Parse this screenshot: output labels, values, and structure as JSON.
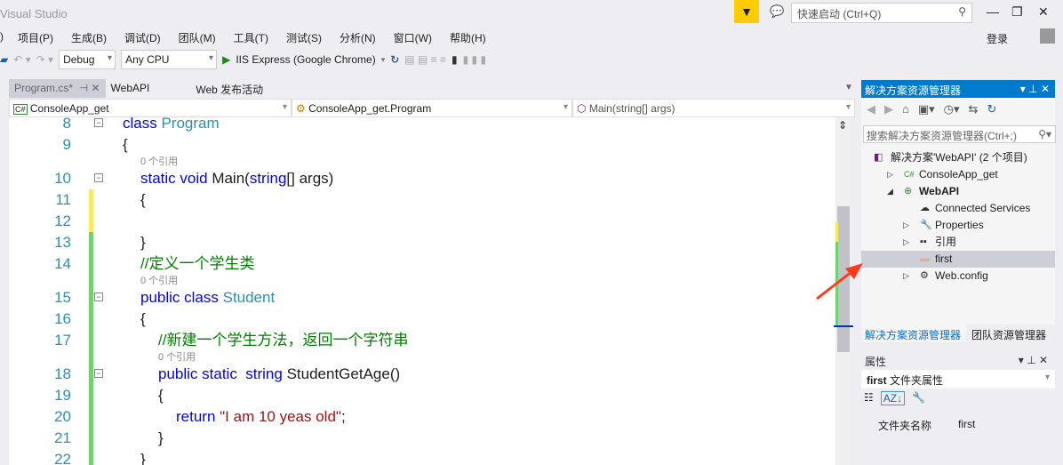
{
  "window": {
    "title": "Visual Studio",
    "quick_launch_placeholder": "快速启动 (Ctrl+Q)",
    "login": "登录"
  },
  "menu": [
    "项目(P)",
    "生成(B)",
    "调试(D)",
    "团队(M)",
    "工具(T)",
    "测试(S)",
    "分析(N)",
    "窗口(W)",
    "帮助(H)"
  ],
  "toolbar": {
    "config": "Debug",
    "platform": "Any CPU",
    "run": "IIS Express (Google Chrome)"
  },
  "tabs": [
    {
      "label": "Program.cs*",
      "active": true
    },
    {
      "label": "WebAPI"
    },
    {
      "label": "Web 发布活动"
    }
  ],
  "nav": {
    "project": "ConsoleApp_get",
    "type": "ConsoleApp_get.Program",
    "member": "Main(string[] args)"
  },
  "code": [
    {
      "type": "line",
      "n": "8",
      "indent": 0,
      "fold": true,
      "tokens": [
        [
          "kw",
          "class "
        ],
        [
          "ty",
          "Program"
        ]
      ]
    },
    {
      "type": "line",
      "n": "9",
      "indent": 0,
      "tokens": [
        [
          "",
          "{"
        ]
      ]
    },
    {
      "type": "ref",
      "indent": 1,
      "text": "0 个引用"
    },
    {
      "type": "line",
      "n": "10",
      "indent": 1,
      "fold": true,
      "tokens": [
        [
          "kw",
          "static void "
        ],
        [
          "",
          "Main("
        ],
        [
          "kw",
          "string"
        ],
        [
          "",
          "[] args)"
        ]
      ]
    },
    {
      "type": "line",
      "n": "11",
      "indent": 1,
      "change": "yellow",
      "tokens": [
        [
          "",
          "{"
        ]
      ]
    },
    {
      "type": "line",
      "n": "12",
      "indent": 1,
      "change": "yellow",
      "tokens": []
    },
    {
      "type": "line",
      "n": "13",
      "indent": 1,
      "change": "green",
      "tokens": [
        [
          "",
          "}"
        ]
      ]
    },
    {
      "type": "line",
      "n": "14",
      "indent": 1,
      "change": "green",
      "tokens": [
        [
          "cm",
          "//定义一个学生类"
        ]
      ]
    },
    {
      "type": "ref",
      "indent": 1,
      "change": "green",
      "text": "0 个引用"
    },
    {
      "type": "line",
      "n": "15",
      "indent": 1,
      "fold": true,
      "change": "green",
      "tokens": [
        [
          "kw",
          "public class "
        ],
        [
          "ty",
          "Student"
        ]
      ]
    },
    {
      "type": "line",
      "n": "16",
      "indent": 1,
      "change": "green",
      "tokens": [
        [
          "",
          "{"
        ]
      ]
    },
    {
      "type": "line",
      "n": "17",
      "indent": 2,
      "change": "green",
      "tokens": [
        [
          "cm",
          "//新建一个学生方法，返回一个字符串"
        ]
      ]
    },
    {
      "type": "ref",
      "indent": 2,
      "change": "green",
      "text": "0 个引用"
    },
    {
      "type": "line",
      "n": "18",
      "indent": 2,
      "fold": true,
      "change": "green",
      "tokens": [
        [
          "kw",
          "public static  string "
        ],
        [
          "",
          "StudentGetAge()"
        ]
      ]
    },
    {
      "type": "line",
      "n": "19",
      "indent": 2,
      "change": "green",
      "tokens": [
        [
          "",
          "{"
        ]
      ]
    },
    {
      "type": "line",
      "n": "20",
      "indent": 3,
      "change": "green",
      "tokens": [
        [
          "kw",
          "return "
        ],
        [
          "st",
          "\"I am 10 yeas old\""
        ],
        [
          "",
          ";"
        ]
      ]
    },
    {
      "type": "line",
      "n": "21",
      "indent": 2,
      "change": "green",
      "tokens": [
        [
          "",
          "}"
        ]
      ]
    },
    {
      "type": "line",
      "n": "22",
      "indent": 1,
      "change": "green",
      "tokens": [
        [
          "",
          "}"
        ]
      ]
    }
  ],
  "solution_explorer": {
    "title": "解决方案资源管理器",
    "search_placeholder": "搜索解决方案资源管理器(Ctrl+;)",
    "items": [
      {
        "label": "解决方案'WebAPI' (2 个项目)",
        "level": 0,
        "icon": "solution-icon",
        "arrow": ""
      },
      {
        "label": "ConsoleApp_get",
        "level": 1,
        "icon": "csharp-project-icon",
        "arrow": "▷"
      },
      {
        "label": "WebAPI",
        "level": 1,
        "icon": "web-project-icon",
        "arrow": "◢",
        "bold": true
      },
      {
        "label": "Connected Services",
        "level": 2,
        "icon": "cloud-icon",
        "arrow": ""
      },
      {
        "label": "Properties",
        "level": 2,
        "icon": "wrench-icon",
        "arrow": "▷"
      },
      {
        "label": "引用",
        "level": 2,
        "icon": "references-icon",
        "arrow": "▷"
      },
      {
        "label": "first",
        "level": 2,
        "icon": "folder-icon",
        "arrow": "",
        "selected": true
      },
      {
        "label": "Web.config",
        "level": 2,
        "icon": "config-icon",
        "arrow": "▷"
      }
    ],
    "tabs": [
      "解决方案资源管理器",
      "团队资源管理器"
    ]
  },
  "properties": {
    "title": "属性",
    "object": "first",
    "object_type": "文件夹属性",
    "rows": [
      {
        "name": "文件夹名称",
        "value": "first"
      }
    ]
  },
  "colors": {
    "accent": "#007acc",
    "yellow_change": "#ffe85f",
    "green_change": "#6fd46f",
    "arrow": "#ff3b1f"
  }
}
